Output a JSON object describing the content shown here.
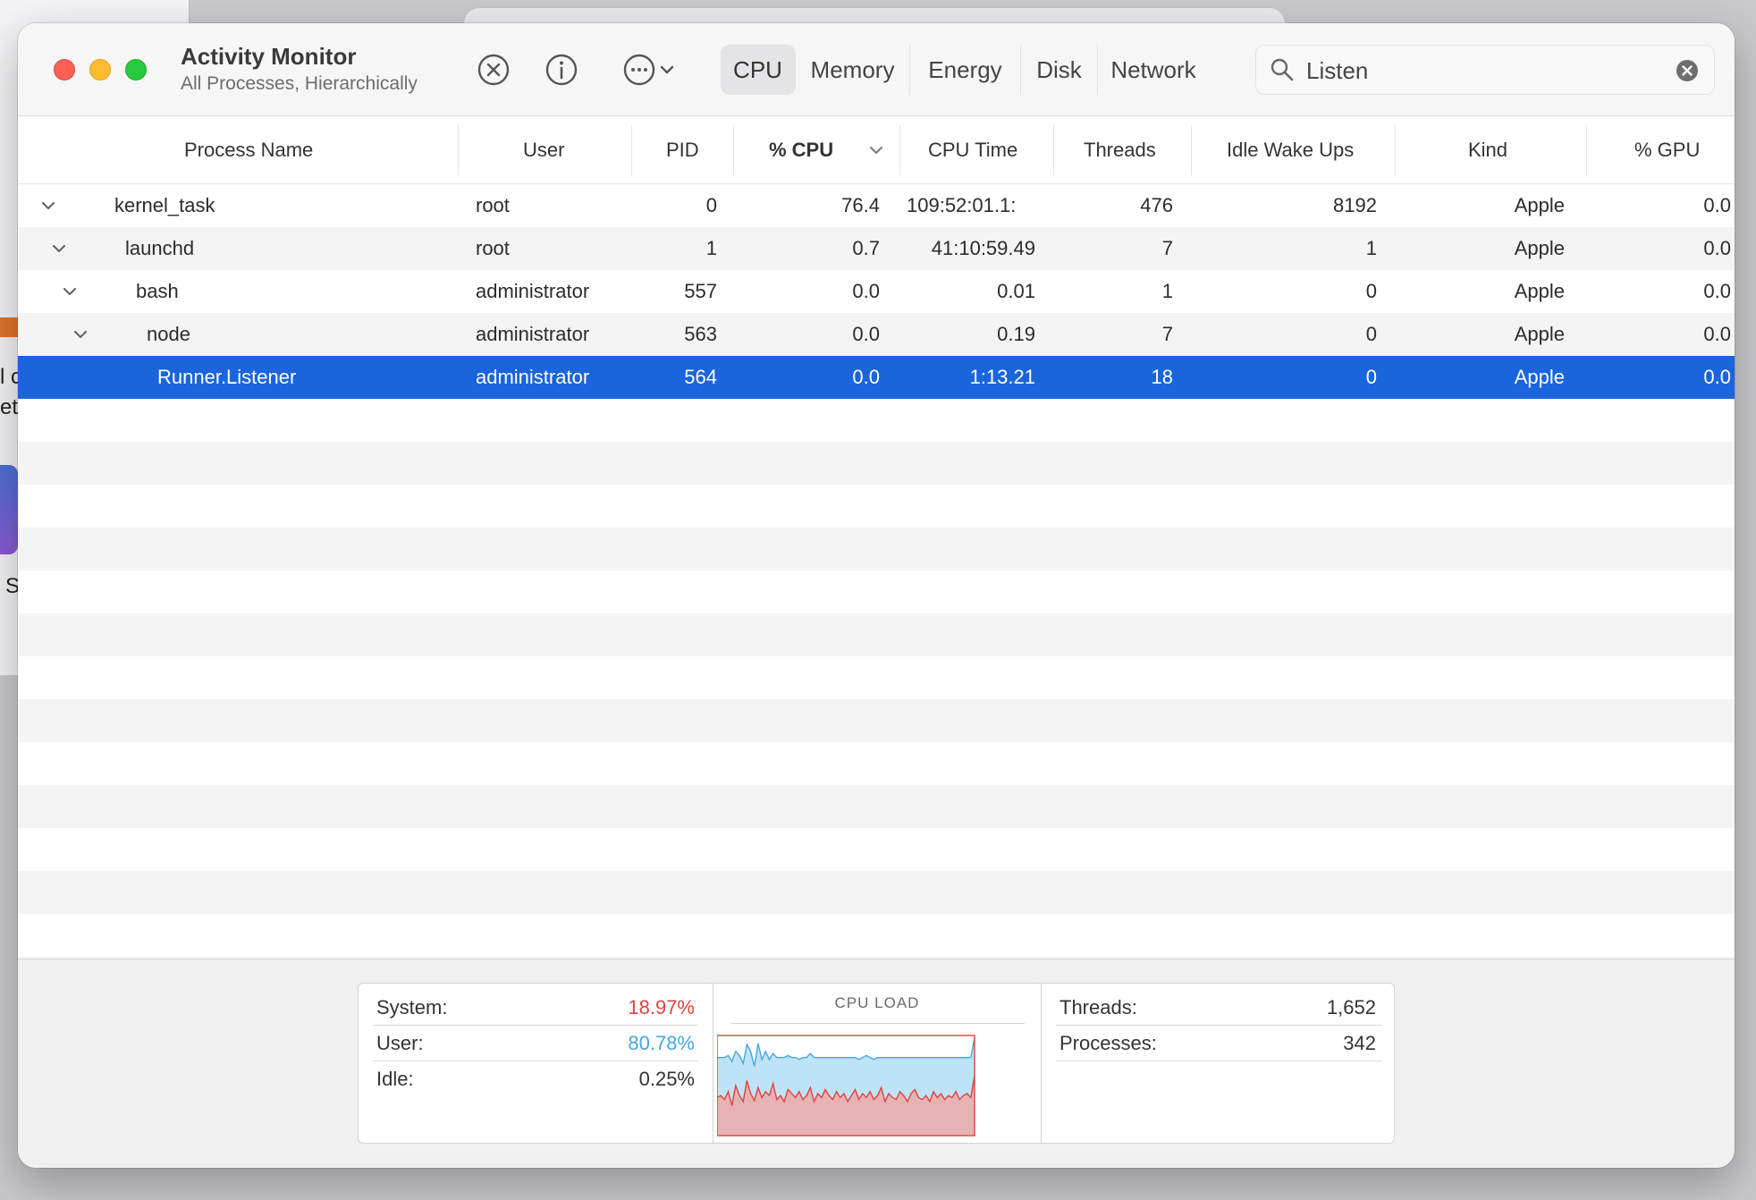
{
  "background": {
    "edge_texts": [
      "l c",
      "et",
      "S"
    ]
  },
  "window": {
    "title": "Activity Monitor",
    "subtitle": "All Processes, Hierarchically",
    "toolbar": {
      "stop_icon": "stop-process-icon",
      "info_icon": "info-icon",
      "more_icon": "more-actions-icon"
    },
    "tabs": [
      {
        "label": "CPU",
        "active": true
      },
      {
        "label": "Memory",
        "active": false
      },
      {
        "label": "Energy",
        "active": false
      },
      {
        "label": "Disk",
        "active": false
      },
      {
        "label": "Network",
        "active": false
      }
    ],
    "search": {
      "value": "Listen",
      "placeholder": "Search"
    }
  },
  "table": {
    "columns": [
      "Process Name",
      "User",
      "PID",
      "% CPU",
      "CPU Time",
      "Threads",
      "Idle Wake Ups",
      "Kind",
      "% GPU"
    ],
    "sort_column": "% CPU",
    "rows": [
      {
        "name": "kernel_task",
        "user": "root",
        "pid": "0",
        "cpu": "76.4",
        "cpu_time": "109:52:01.1:",
        "threads": "476",
        "idle_wake_ups": "8192",
        "kind": "Apple",
        "gpu": "0.0",
        "level": 0,
        "expanded": true,
        "selected": false
      },
      {
        "name": "launchd",
        "user": "root",
        "pid": "1",
        "cpu": "0.7",
        "cpu_time": "41:10:59.49",
        "threads": "7",
        "idle_wake_ups": "1",
        "kind": "Apple",
        "gpu": "0.0",
        "level": 1,
        "expanded": true,
        "selected": false
      },
      {
        "name": "bash",
        "user": "administrator",
        "pid": "557",
        "cpu": "0.0",
        "cpu_time": "0.01",
        "threads": "1",
        "idle_wake_ups": "0",
        "kind": "Apple",
        "gpu": "0.0",
        "level": 2,
        "expanded": true,
        "selected": false
      },
      {
        "name": "node",
        "user": "administrator",
        "pid": "563",
        "cpu": "0.0",
        "cpu_time": "0.19",
        "threads": "7",
        "idle_wake_ups": "0",
        "kind": "Apple",
        "gpu": "0.0",
        "level": 3,
        "expanded": true,
        "selected": false
      },
      {
        "name": "Runner.Listener",
        "user": "administrator",
        "pid": "564",
        "cpu": "0.0",
        "cpu_time": "1:13.21",
        "threads": "18",
        "idle_wake_ups": "0",
        "kind": "Apple",
        "gpu": "0.0",
        "level": 4,
        "expanded": false,
        "selected": true
      }
    ]
  },
  "summary": {
    "system_label": "System:",
    "system_value": "18.97%",
    "user_label": "User:",
    "user_value": "80.78%",
    "idle_label": "Idle:",
    "idle_value": "0.25%",
    "chart_title": "CPU LOAD",
    "threads_label": "Threads:",
    "threads_value": "1,652",
    "processes_label": "Processes:",
    "processes_value": "342"
  },
  "colors": {
    "selection": "#1a64dc",
    "system": "#e0433f",
    "user": "#48a6e0",
    "close": "#fe5f57",
    "minimize": "#febc2e",
    "zoom": "#28c840"
  },
  "chart_data": {
    "type": "area",
    "title": "CPU LOAD",
    "ylim": [
      0,
      100
    ],
    "x": [
      1,
      2,
      3,
      4,
      5,
      6,
      7,
      8,
      9,
      10,
      11,
      12,
      13,
      14,
      15,
      16,
      17,
      18,
      19,
      20,
      21,
      22,
      23,
      24,
      25,
      26,
      27,
      28,
      29,
      30,
      31,
      32,
      33,
      34,
      35,
      36,
      37,
      38,
      39,
      40,
      41,
      42,
      43,
      44,
      45,
      46,
      47,
      48,
      49,
      50,
      51,
      52,
      53,
      54,
      55,
      56,
      57,
      58,
      59,
      60,
      61,
      62,
      63,
      64,
      65,
      66,
      67,
      68,
      69,
      70
    ],
    "series": [
      {
        "name": "System",
        "color": "#e0433f",
        "values": [
          38,
          40,
          36,
          44,
          30,
          50,
          40,
          34,
          55,
          42,
          35,
          48,
          38,
          44,
          40,
          52,
          36,
          40,
          34,
          46,
          42,
          38,
          44,
          36,
          40,
          48,
          34,
          42,
          38,
          46,
          40,
          36,
          44,
          38,
          42,
          34,
          40,
          46,
          36,
          42,
          38,
          44,
          36,
          40,
          48,
          34,
          42,
          38,
          36,
          44,
          40,
          34,
          42,
          46,
          38,
          36,
          40,
          34,
          44,
          38,
          42,
          36,
          40,
          38,
          44,
          36,
          40,
          42,
          38,
          60
        ]
      },
      {
        "name": "User",
        "color": "#48a6e0",
        "values": [
          40,
          38,
          42,
          36,
          44,
          34,
          40,
          38,
          36,
          42,
          34,
          44,
          38,
          40,
          36,
          30,
          42,
          38,
          44,
          34,
          36,
          40,
          32,
          42,
          38,
          34,
          44,
          36,
          40,
          32,
          38,
          42,
          34,
          40,
          36,
          44,
          38,
          32,
          40,
          36,
          42,
          34,
          40,
          38,
          30,
          44,
          36,
          40,
          42,
          34,
          38,
          44,
          36,
          32,
          40,
          42,
          38,
          44,
          34,
          40,
          36,
          42,
          38,
          40,
          34,
          42,
          38,
          36,
          40,
          38
        ]
      }
    ]
  }
}
